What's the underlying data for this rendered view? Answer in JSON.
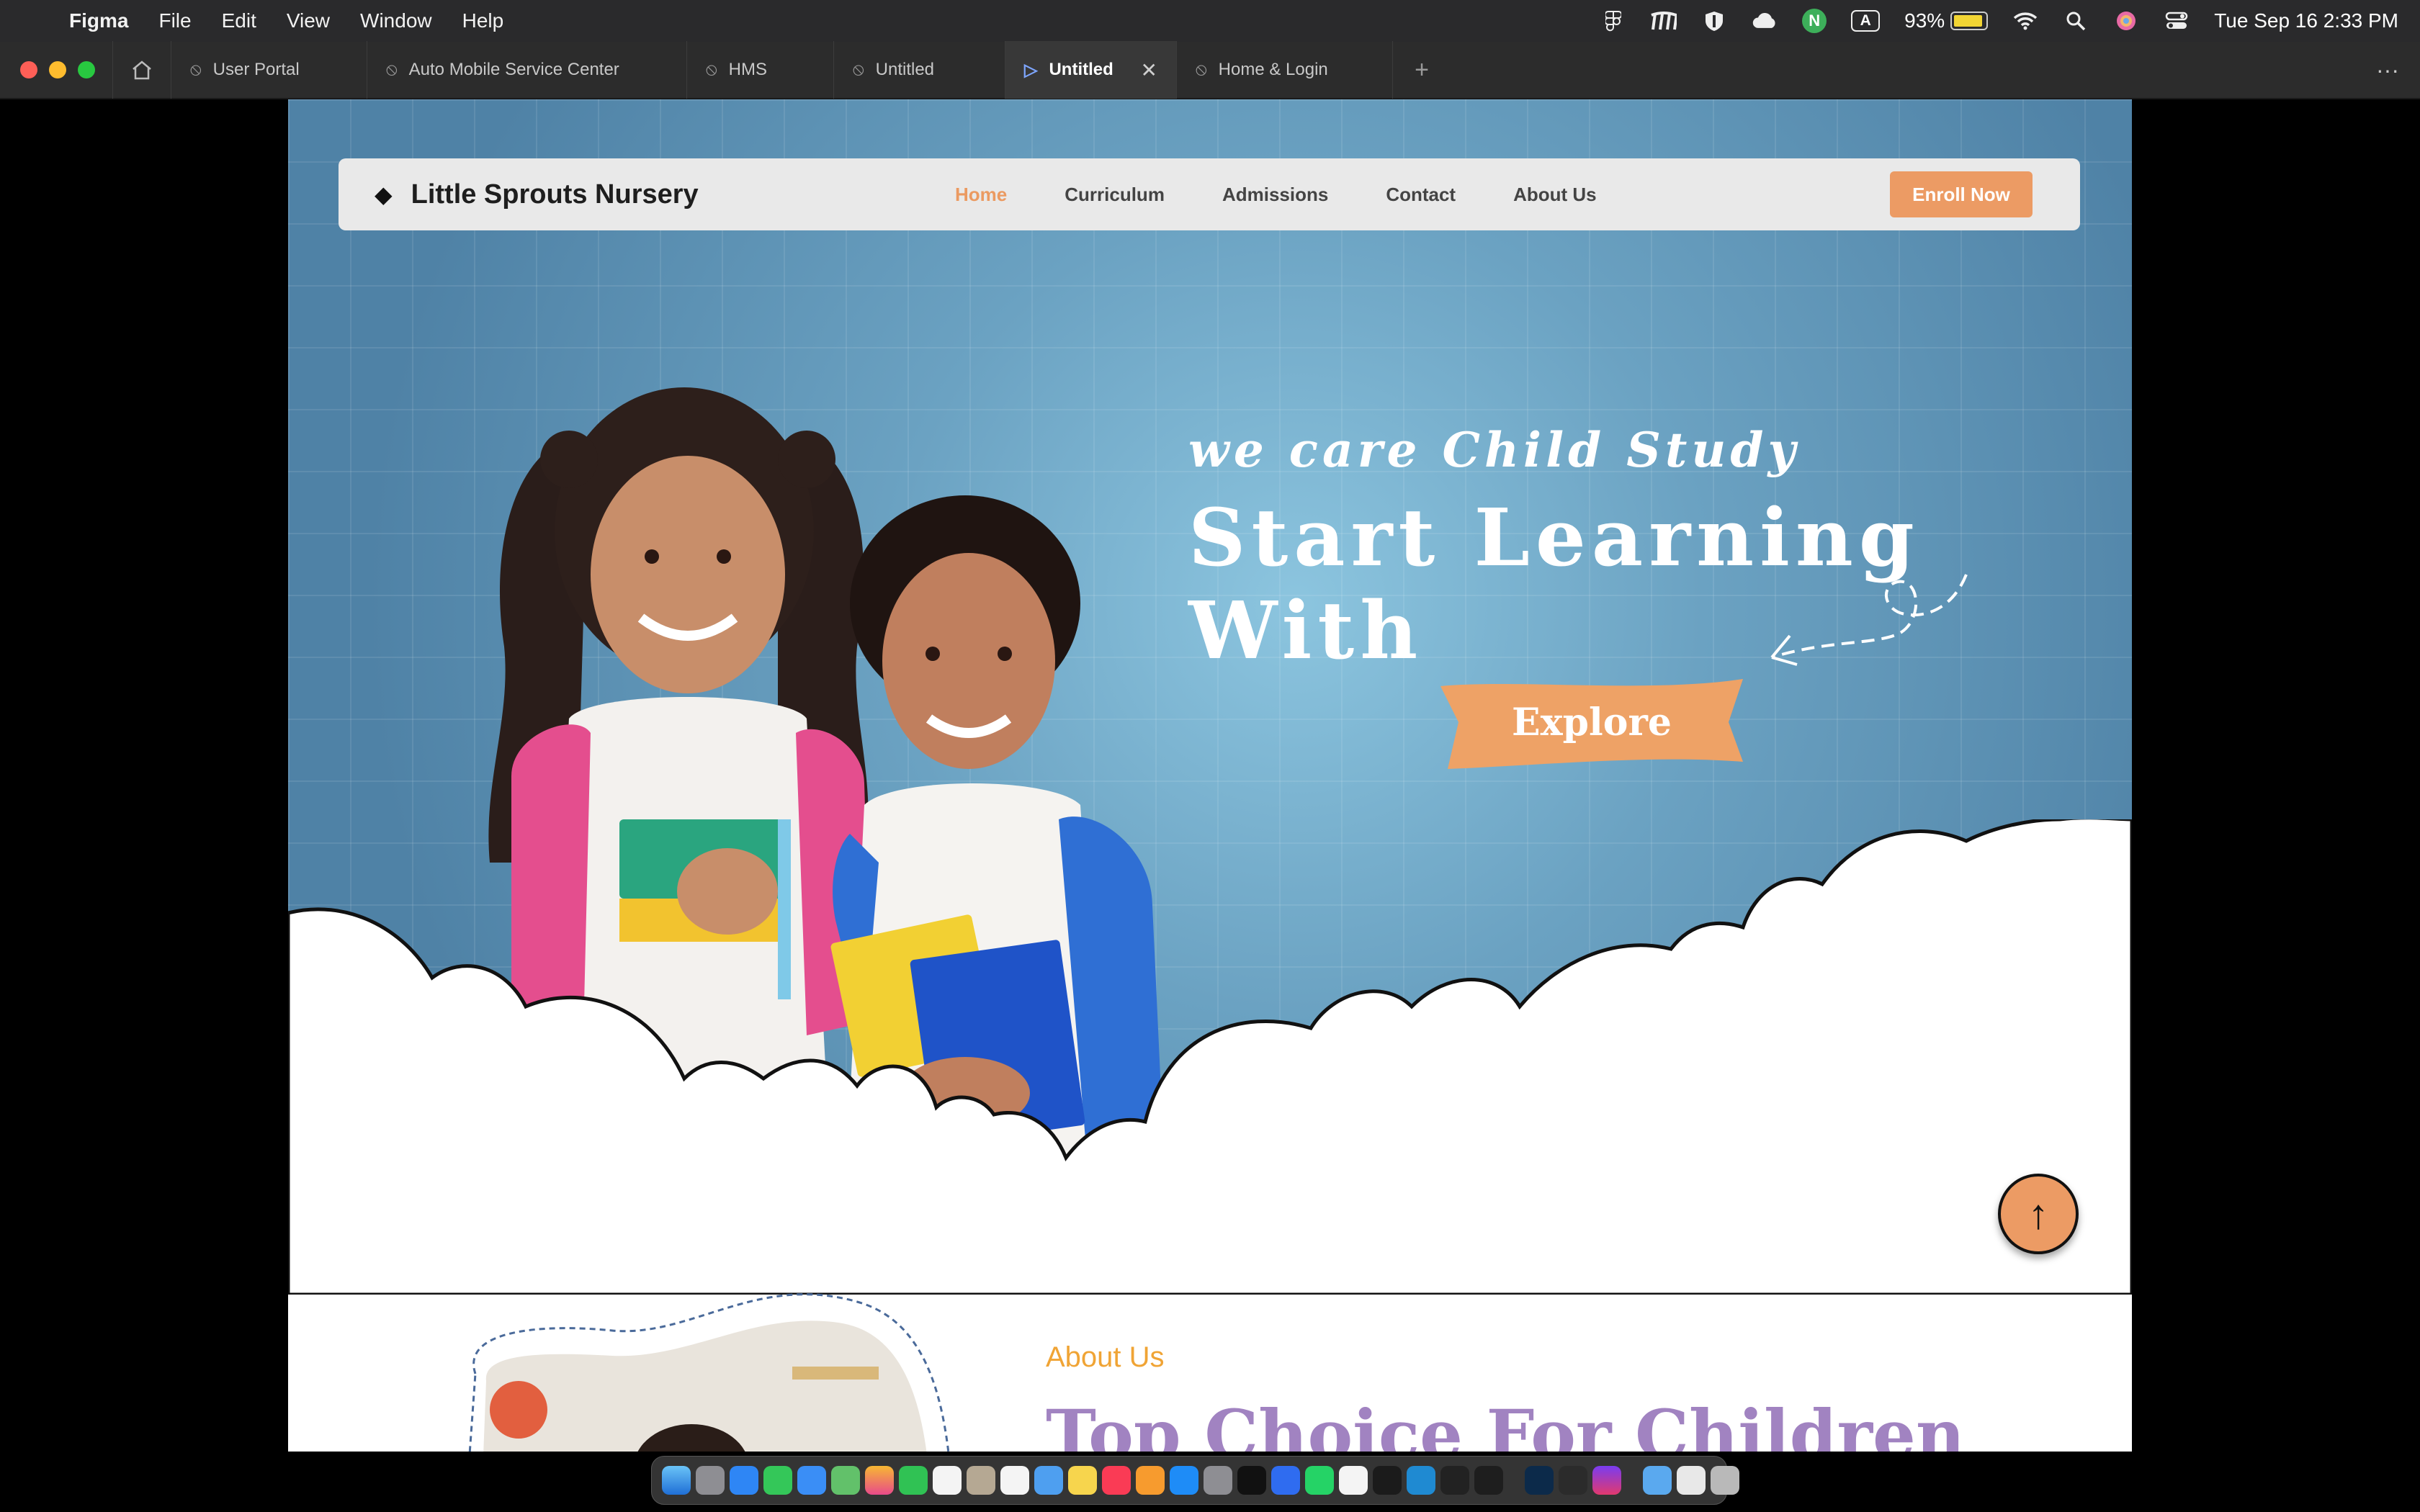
{
  "menubar": {
    "app_name": "Figma",
    "items": [
      "File",
      "Edit",
      "View",
      "Window",
      "Help"
    ],
    "battery": "93%",
    "datetime": "Tue Sep 16  2:33 PM",
    "battery_level": 0.93,
    "status_icons": [
      "figma-icon",
      "extension-icon",
      "shield-icon",
      "cloud-icon",
      "n-icon",
      "a-input-icon",
      "battery-icon",
      "wifi-icon",
      "search-icon",
      "user-icon",
      "control-center-icon"
    ]
  },
  "tabs": [
    {
      "label": "User Portal",
      "active": false
    },
    {
      "label": "Auto Mobile Service Center",
      "active": false
    },
    {
      "label": "HMS",
      "active": false
    },
    {
      "label": "Untitled",
      "active": false
    },
    {
      "label": "Untitled",
      "active": true
    },
    {
      "label": "Home & Login",
      "active": false
    }
  ],
  "site": {
    "brand": "Little Sprouts Nursery",
    "nav": [
      "Home",
      "Curriculum",
      "Admissions",
      "Contact",
      "About Us"
    ],
    "enroll": "Enroll Now",
    "hero_subtitle": "we care Child Study",
    "hero_title": "Start Learning With",
    "explore": "Explore",
    "back_to_top": "↑",
    "about_label": "About Us",
    "about_title": "Top Choice For Children"
  },
  "colors": {
    "accent": "#ec9b64",
    "hero_bg": "#6ba2c2",
    "about_title": "#a183c1",
    "about_label": "#f0a435"
  },
  "dock": [
    "finder",
    "launchpad",
    "safari",
    "messages",
    "mail",
    "maps",
    "photos",
    "facetime",
    "calendar",
    "contacts",
    "reminders",
    "freeform",
    "notes",
    "music",
    "pages",
    "app-store",
    "settings",
    "apple-tv",
    "keynote",
    "whatsapp",
    "textedit",
    "chatgpt",
    "vscode",
    "terminal-2",
    "figma",
    "photoshop",
    "terminal",
    "affinity",
    "folder",
    "preview",
    "trash"
  ]
}
